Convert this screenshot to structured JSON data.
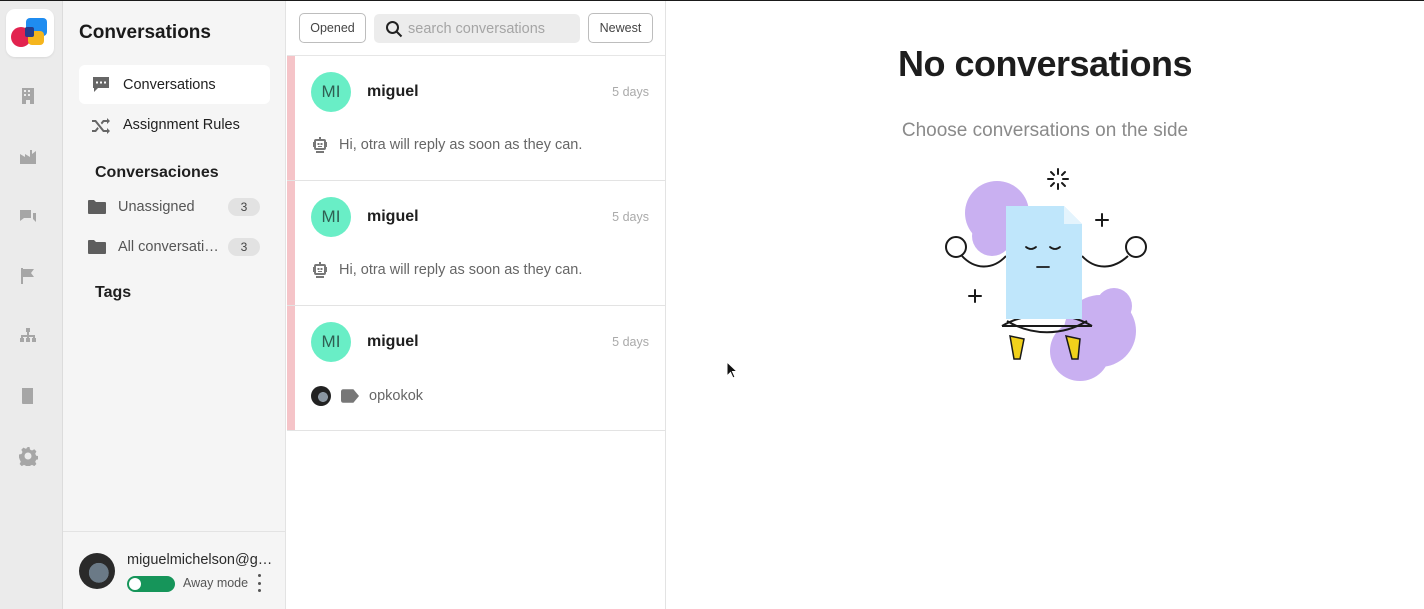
{
  "rail": {
    "items": [
      {
        "name": "building-icon"
      },
      {
        "name": "factory-icon"
      },
      {
        "name": "chat-bubbles-icon"
      },
      {
        "name": "flag-icon"
      },
      {
        "name": "sitemap-icon"
      },
      {
        "name": "book-icon"
      },
      {
        "name": "gear-icon"
      }
    ]
  },
  "nav": {
    "title": "Conversations",
    "items": [
      {
        "label": "Conversations",
        "icon": "chat-icon",
        "active": true
      },
      {
        "label": "Assignment Rules",
        "icon": "shuffle-icon",
        "active": false
      }
    ],
    "sections": {
      "conversaciones_title": "Conversaciones",
      "folders": [
        {
          "label": "Unassigned",
          "count": "3"
        },
        {
          "label": "All conversations",
          "count": "3"
        }
      ],
      "tags_title": "Tags"
    },
    "user": {
      "email": "miguelmichelson@gmail.com",
      "status_label": "Away mode"
    }
  },
  "list": {
    "filter_label": "Opened",
    "search_placeholder": "search conversations",
    "sort_label": "Newest",
    "conversations": [
      {
        "initials": "MI",
        "name": "miguel",
        "time": "5 days",
        "preview": "Hi, otra will reply as soon as they can.",
        "preview_icon": "bot-icon"
      },
      {
        "initials": "MI",
        "name": "miguel",
        "time": "5 days",
        "preview": "Hi, otra will reply as soon as they can.",
        "preview_icon": "bot-icon"
      },
      {
        "initials": "MI",
        "name": "miguel",
        "time": "5 days",
        "preview": "opkokok",
        "preview_icon": "tag-icon"
      }
    ]
  },
  "main": {
    "title": "No conversations",
    "subtitle": "Choose conversations on the side"
  },
  "colors": {
    "avatar_bg": "#69eec6",
    "unread_stripe": "#f5c4c8",
    "toggle_on": "#16955a",
    "blob_purple": "#c8aef0",
    "paper_blue": "#bfe6fb"
  }
}
